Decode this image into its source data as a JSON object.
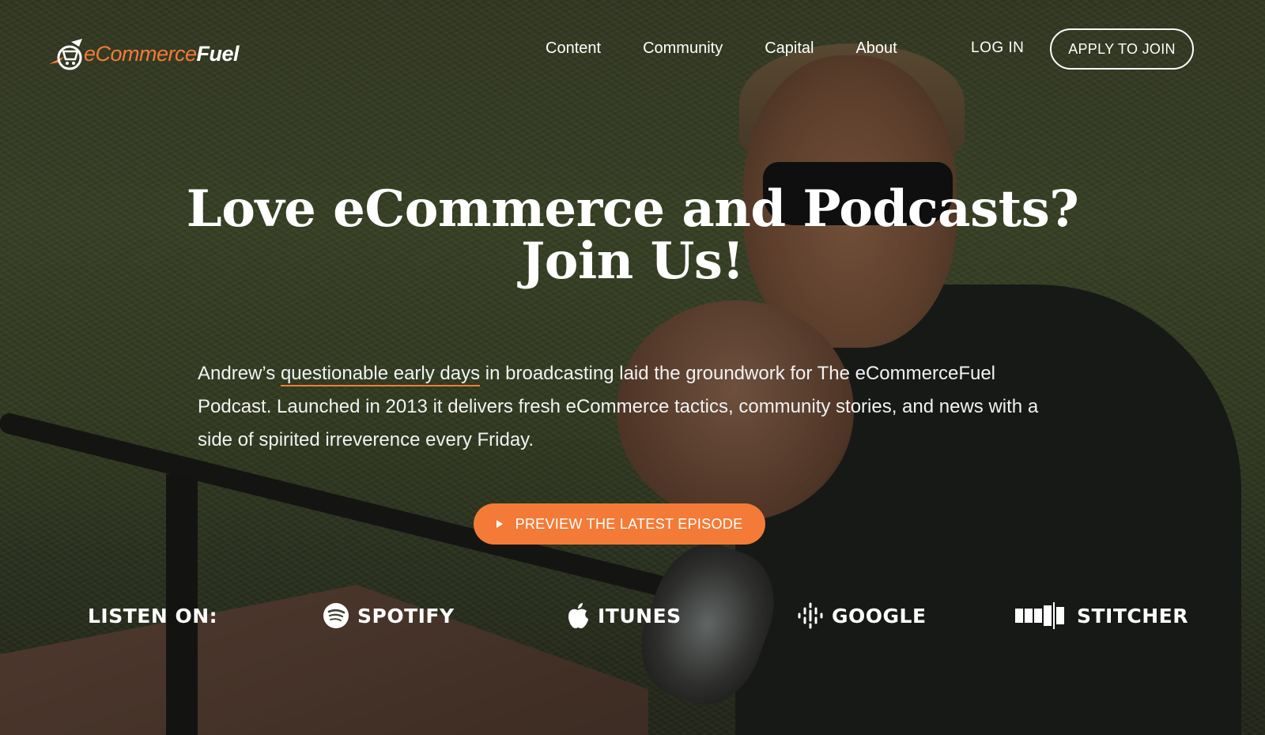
{
  "brand": {
    "logo_part1": "eCommerce",
    "logo_part2": "Fuel",
    "accent_color": "#f37b37"
  },
  "nav": {
    "items": [
      {
        "label": "Content"
      },
      {
        "label": "Community"
      },
      {
        "label": "Capital"
      },
      {
        "label": "About"
      }
    ],
    "login_label": "LOG IN",
    "apply_label": "APPLY TO JOIN"
  },
  "hero": {
    "headline_line1": "Love eCommerce and Podcasts?",
    "headline_line2": "Join Us!",
    "body_prefix": "Andrew’s ",
    "body_link": "questionable early days",
    "body_suffix": " in broadcasting laid the groundwork for The eCommerceFuel Podcast. Launched in 2013 it delivers fresh eCommerce tactics, community stories, and news with a side of spirited irreverence every Friday.",
    "cta_label": "PREVIEW THE LATEST EPISODE"
  },
  "listen": {
    "label": "LISTEN ON:",
    "platforms": [
      {
        "name": "SPOTIFY",
        "icon": "spotify-icon"
      },
      {
        "name": "ITUNES",
        "icon": "apple-icon"
      },
      {
        "name": "GOOGLE",
        "icon": "google-podcasts-icon"
      },
      {
        "name": "STITCHER",
        "icon": "stitcher-icon"
      }
    ]
  }
}
